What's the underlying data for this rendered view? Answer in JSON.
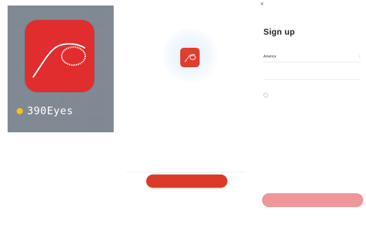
{
  "home_icon": {
    "app_name": "390Eyes",
    "icon_name": "390eyes-logo-icon",
    "badge_icon": "new-install-dot-icon",
    "colors": {
      "icon_bg": "#e12d2d",
      "dot": "#f4c21d",
      "wallpaper": "#7e8691"
    }
  },
  "welcome": {
    "logo_icon": "390eyes-logo-icon",
    "primary_button_label": "",
    "secondary_link_label": "",
    "colors": {
      "accent": "#dc3a29"
    }
  },
  "signup": {
    "back_icon": "close-icon",
    "title": "Sign up",
    "country": {
      "value": "America",
      "icon": "chevron-right-icon"
    },
    "account_field": {
      "placeholder": ""
    },
    "terms": {
      "text": "",
      "user_agreement": "",
      "privacy_policy": ""
    },
    "submit_button_label": "",
    "colors": {
      "button_disabled": "#ef9698"
    }
  }
}
